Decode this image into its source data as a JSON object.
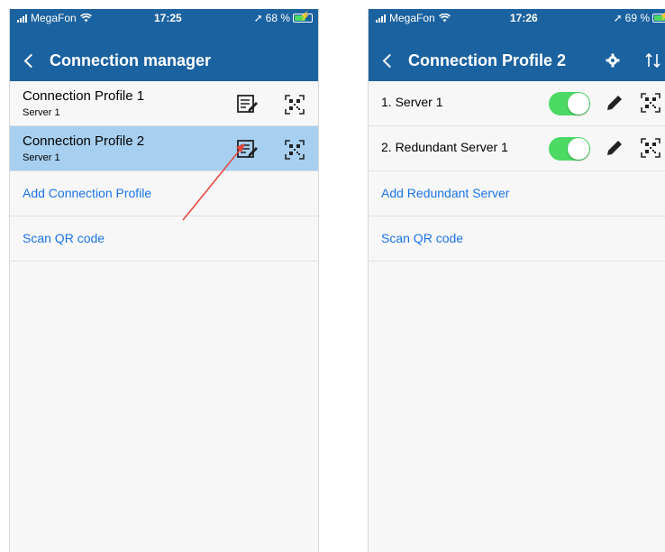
{
  "colors": {
    "nav_bg": "#1b62a0",
    "row_selected_bg": "#a7cff0",
    "link_color": "#1a73e8",
    "toggle_on": "#4cd964",
    "annotation_arrow": "#e8463d"
  },
  "left_screen": {
    "status": {
      "carrier": "MegaFon",
      "time": "17:25",
      "battery_percent": "68 %",
      "battery_level": 0.68
    },
    "nav": {
      "title": "Connection manager",
      "back_icon": "chevron-left-icon"
    },
    "profiles": [
      {
        "title": "Connection Profile 1",
        "subtitle": "Server 1",
        "selected": false,
        "edit_icon": "edit-list-icon",
        "qr_icon": "qr-code-icon"
      },
      {
        "title": "Connection Profile 2",
        "subtitle": "Server 1",
        "selected": true,
        "edit_icon": "edit-list-icon",
        "qr_icon": "qr-code-icon"
      }
    ],
    "actions": {
      "add_profile": "Add Connection Profile",
      "scan_qr": "Scan QR code"
    }
  },
  "right_screen": {
    "status": {
      "carrier": "MegaFon",
      "time": "17:26",
      "battery_percent": "69 %",
      "battery_level": 0.69
    },
    "nav": {
      "title": "Connection Profile 2",
      "back_icon": "chevron-left-icon",
      "settings_icon": "gear-icon",
      "sort_icon": "sort-icon"
    },
    "servers": [
      {
        "label": "1. Server 1",
        "enabled": true,
        "edit_icon": "pencil-icon",
        "qr_icon": "qr-code-icon"
      },
      {
        "label": "2. Redundant Server 1",
        "enabled": true,
        "edit_icon": "pencil-icon",
        "qr_icon": "qr-code-icon"
      }
    ],
    "actions": {
      "add_redundant": "Add Redundant Server",
      "scan_qr": "Scan QR code"
    }
  }
}
